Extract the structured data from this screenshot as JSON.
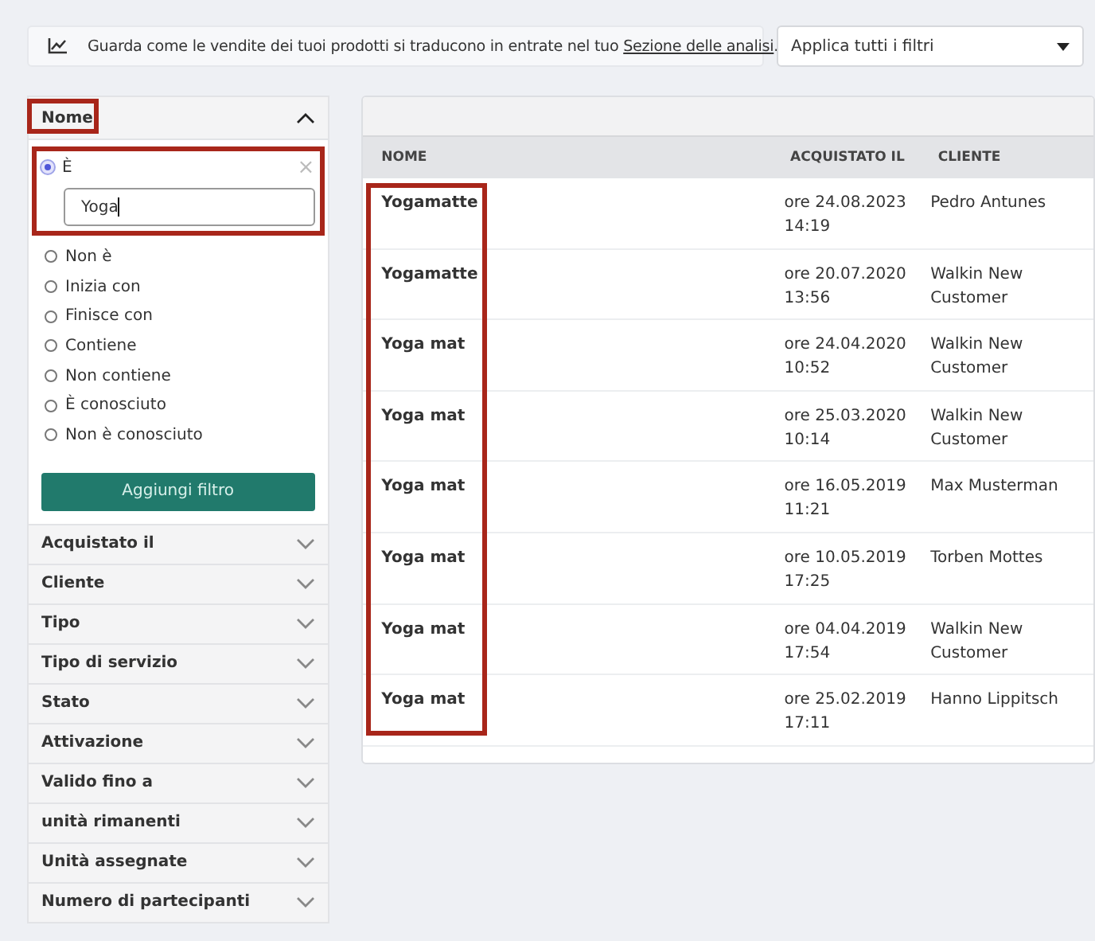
{
  "banner": {
    "text": "Guarda come le vendite dei tuoi prodotti si traducono in entrate nel tuo ",
    "link": "Sezione delle analisi",
    "after": "."
  },
  "filter_select": {
    "value": "Applica tutti i filtri"
  },
  "filters": [
    {
      "label": "Nome",
      "expanded": true,
      "options": [
        {
          "label": "È",
          "selected": true
        },
        {
          "label": "Non è",
          "selected": false
        },
        {
          "label": "Inizia con",
          "selected": false
        },
        {
          "label": "Finisce con",
          "selected": false
        },
        {
          "label": "Contiene",
          "selected": false
        },
        {
          "label": "Non contiene",
          "selected": false
        },
        {
          "label": "È conosciuto",
          "selected": false
        },
        {
          "label": "Non è conosciuto",
          "selected": false
        }
      ],
      "value": "Yoga",
      "clear": "×",
      "button": "Aggiungi filtro"
    },
    {
      "label": "Acquistato il",
      "expanded": false
    },
    {
      "label": "Cliente",
      "expanded": false
    },
    {
      "label": "Tipo",
      "expanded": false
    },
    {
      "label": "Tipo di servizio",
      "expanded": false
    },
    {
      "label": "Stato",
      "expanded": false
    },
    {
      "label": "Attivazione",
      "expanded": false
    },
    {
      "label": "Valido fino a",
      "expanded": false
    },
    {
      "label": "unità rimanenti",
      "expanded": false
    },
    {
      "label": "Unità assegnate",
      "expanded": false
    },
    {
      "label": "Numero di partecipanti",
      "expanded": false
    }
  ],
  "table": {
    "columns": [
      "NOME",
      "ACQUISTATO IL",
      "CLIENTE"
    ],
    "rows": [
      [
        "Yogamatte",
        "ore 24.08.2023 14:19",
        "Pedro Antunes"
      ],
      [
        "Yogamatte",
        "ore 20.07.2020 13:56",
        "Walkin New Customer"
      ],
      [
        "Yoga mat",
        "ore 24.04.2020 10:52",
        "Walkin New Customer"
      ],
      [
        "Yoga mat",
        "ore 25.03.2020 10:14",
        "Walkin New Customer"
      ],
      [
        "Yoga mat",
        "ore 16.05.2019 11:21",
        "Max Musterman"
      ],
      [
        "Yoga mat",
        "ore 10.05.2019 17:25",
        "Torben Mottes"
      ],
      [
        "Yoga mat",
        "ore 04.04.2019 17:54",
        "Walkin New Customer"
      ],
      [
        "Yoga mat",
        "ore 25.02.2019 17:11",
        "Hanno Lippitsch"
      ]
    ]
  }
}
